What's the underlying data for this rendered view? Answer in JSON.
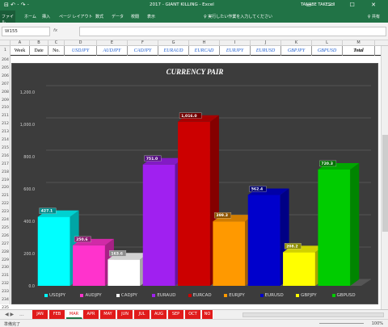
{
  "window": {
    "title": "2017 - GIANT KILLING  -  Excel",
    "user": "TANABE TAKESHI",
    "qa_icons": "⊟ ↶ · ↷ ·",
    "controls": "▭ — ☐ ✕"
  },
  "ribbon": {
    "file": "ファイル",
    "tabs": [
      "ホーム",
      "挿入",
      "ページ レイアウト",
      "数式",
      "データ",
      "校閲",
      "表示"
    ],
    "tellme": "♀ 実行したい作業を入力してください",
    "share": "♀ 共有"
  },
  "formula_bar": {
    "name_box": "W155",
    "fx_label": "fx"
  },
  "columns": [
    "A",
    "B",
    "C",
    "D",
    "E",
    "F",
    "G",
    "H",
    "I",
    "J",
    "K",
    "L",
    "M"
  ],
  "header_row": {
    "row_number": "1",
    "week": "Week",
    "date": "Date",
    "no": "No.",
    "pairs": [
      "USDJPY",
      "AUDJPY",
      "CADJPY",
      "EURAUD",
      "EURCAD",
      "EURJPY",
      "EURUSD",
      "GBPJPY",
      "GBPUSD"
    ],
    "total": "Total"
  },
  "row_numbers": [
    "204",
    "205",
    "206",
    "207",
    "208",
    "209",
    "210",
    "211",
    "212",
    "213",
    "214",
    "215",
    "216",
    "217",
    "218",
    "219",
    "220",
    "221",
    "222",
    "223",
    "224",
    "225",
    "226",
    "227",
    "228",
    "229",
    "230",
    "231",
    "232",
    "233",
    "234",
    "235"
  ],
  "chart_data": {
    "type": "bar",
    "title": "CURRENCY PAIR",
    "categories": [
      "USDJPY",
      "AUDJPY",
      "CADJPY",
      "EURAUD",
      "EURCAD",
      "EURJPY",
      "EURUSD",
      "GBPJPY",
      "GBPUSD"
    ],
    "values": [
      427.1,
      250.6,
      163.6,
      751.0,
      1016.0,
      399.3,
      562.4,
      208.2,
      720.3
    ],
    "value_labels": [
      "427.1",
      "250.6",
      "163.6",
      "751.0",
      "1,016.0",
      "399.3",
      "562.4",
      "208.2",
      "720.3"
    ],
    "colors": [
      "#00ffff",
      "#ff33cc",
      "#ffffff",
      "#a020f0",
      "#cc0000",
      "#ff9900",
      "#0000cc",
      "#ffff00",
      "#00cc00"
    ],
    "yticks": [
      "0.0",
      "200.0",
      "400.0",
      "600.0",
      "800.0",
      "1,000.0",
      "1,200.0"
    ],
    "ylim": [
      0,
      1200
    ],
    "grid": true,
    "legend": "bottom",
    "background": "#3c3c3c"
  },
  "sheet_tabs": {
    "nav": "◀ ▶",
    "tabs": [
      "JAN",
      "FEB",
      "MAR",
      "APR",
      "MAY",
      "JUN",
      "JUL",
      "AUG",
      "SEP",
      "OCT",
      "NO"
    ],
    "active": "MAR",
    "more": "..."
  },
  "status_bar": {
    "status": "準備完了",
    "zoom": "100%"
  }
}
